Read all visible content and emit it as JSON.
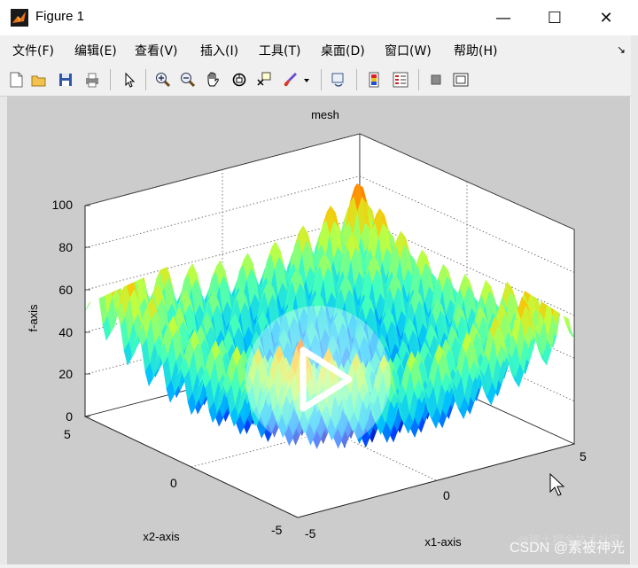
{
  "window": {
    "title": "Figure 1",
    "minimize_glyph": "—",
    "maximize_glyph": "☐",
    "close_glyph": "✕"
  },
  "menu": {
    "items": [
      "文件(F)",
      "编辑(E)",
      "查看(V)",
      "插入(I)",
      "工具(T)",
      "桌面(D)",
      "窗口(W)",
      "帮助(H)"
    ],
    "dock_glyph": "↘"
  },
  "toolbar": {
    "icons": [
      "new-figure-icon",
      "open-file-icon",
      "save-icon",
      "print-icon",
      "select-arrow-icon",
      "zoom-in-icon",
      "zoom-out-icon",
      "pan-hand-icon",
      "rotate-3d-icon",
      "data-cursor-icon",
      "brush-icon",
      "brush-dropdown-icon",
      "link-plot-icon",
      "colorbar-icon",
      "legend-icon",
      "hide-plot-tools-icon",
      "show-plot-tools-icon"
    ]
  },
  "plot": {
    "title": "mesh",
    "xlabel": "x1-axis",
    "ylabel": "x2-axis",
    "zlabel": "f-axis",
    "z_ticks": [
      "0",
      "20",
      "40",
      "60",
      "80",
      "100"
    ],
    "x1_ticks": [
      "-5",
      "0",
      "5"
    ],
    "x2_ticks": [
      "5",
      "0",
      "-5"
    ]
  },
  "overlay": {
    "watermark": "CSDN @素被神光",
    "watermark_shadow": "@稀土掘金技术社区"
  },
  "chart_data": {
    "type": "surface",
    "title": "mesh",
    "xlabel": "x1-axis",
    "ylabel": "x2-axis",
    "zlabel": "f-axis",
    "xlim": [
      -5,
      5
    ],
    "ylim": [
      -5,
      5
    ],
    "zlim": [
      0,
      100
    ],
    "grid": true,
    "colormap": "jet",
    "description_values": {
      "min_z": 0,
      "max_z": 100,
      "center_value": 0,
      "corner_value": 80
    }
  }
}
